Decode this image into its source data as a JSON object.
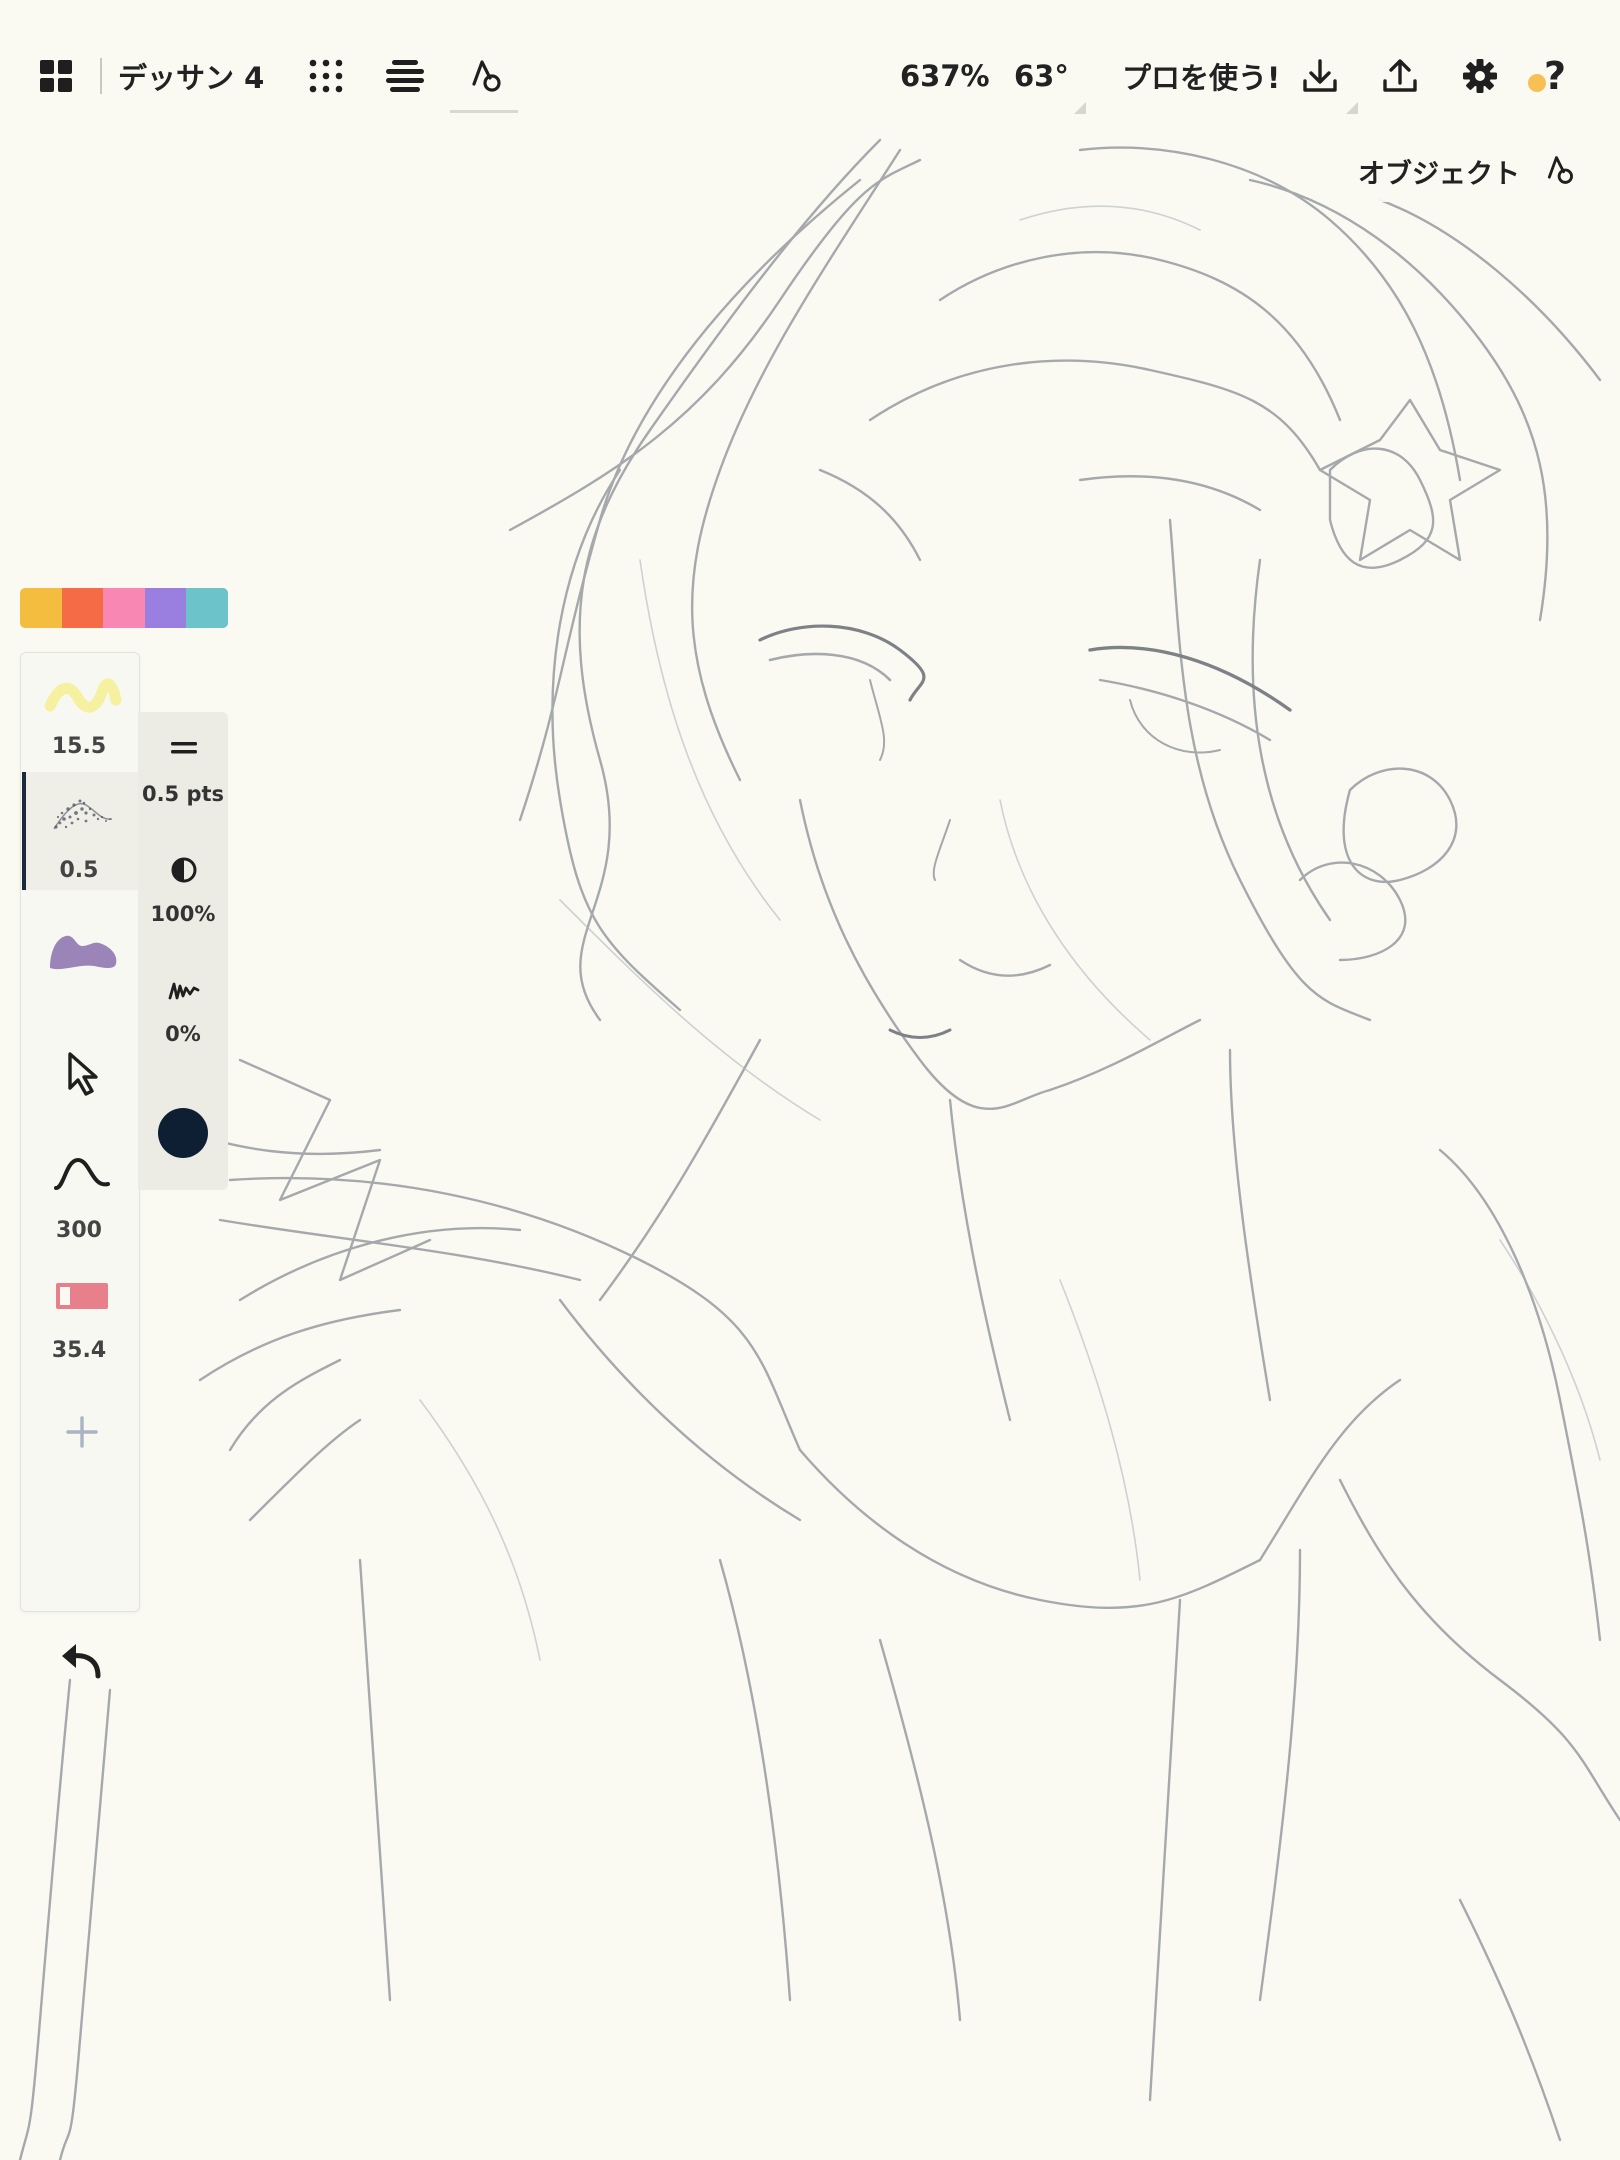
{
  "document": {
    "title": "デッサン 4"
  },
  "topbar": {
    "zoom": "637%",
    "rotation": "63°",
    "pro_label": "プロを使う!",
    "help_label": "?"
  },
  "object_panel": {
    "label": "オブジェクト"
  },
  "palette": {
    "colors": [
      "#f5bd3f",
      "#f56b45",
      "#f887b4",
      "#9a7fe0",
      "#6cc3c9"
    ]
  },
  "brushes": [
    {
      "value": "15.5",
      "color": "#f5f1a0",
      "icon": "highlighter-brush-icon"
    },
    {
      "value": "0.5",
      "color": "#4a5060",
      "icon": "pencil-texture-brush-icon",
      "selected": true
    },
    {
      "value": "",
      "color": "#9a84b8",
      "icon": "marker-blob-brush-icon"
    }
  ],
  "tools": {
    "select_icon": "cursor-arrow-icon",
    "smoothing_value": "300",
    "eraser_value": "35.4",
    "eraser_color": "#e8808c",
    "add_icon": "plus-icon",
    "undo_icon": "undo-icon"
  },
  "brush_settings": {
    "size": "0.5 pts",
    "opacity": "100%",
    "pressure": "0%",
    "current_color": "#0f1f33"
  }
}
